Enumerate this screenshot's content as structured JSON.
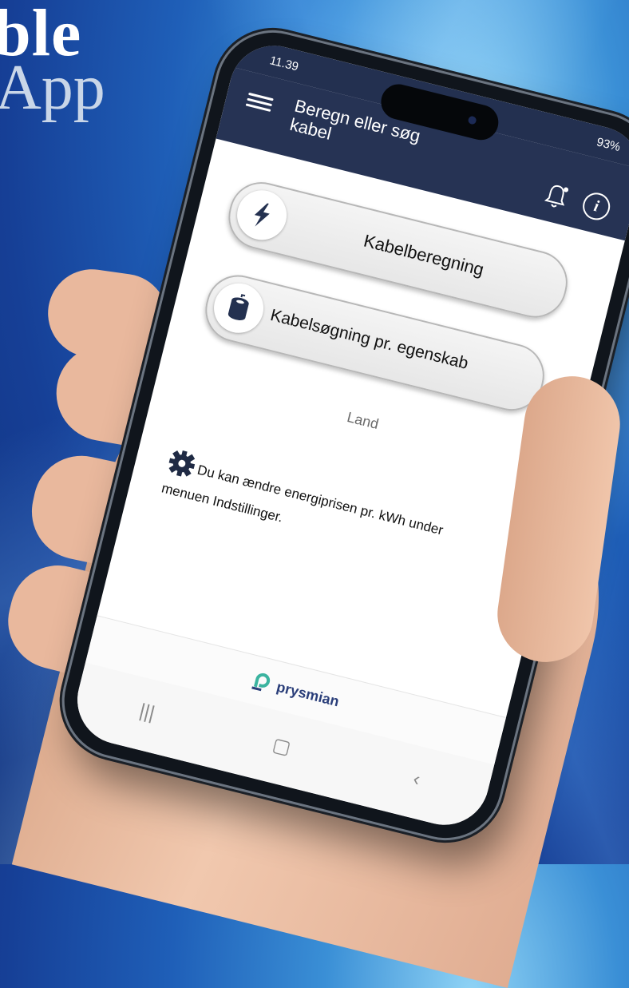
{
  "brand": {
    "top": "ble",
    "bottom": "App"
  },
  "status_bar": {
    "time": "11.39",
    "battery": "93%"
  },
  "app_bar": {
    "menu_icon": "hamburger-menu-icon",
    "title": "Beregn eller søg kabel",
    "notification_icon": "bell-icon",
    "info_icon": "info-icon",
    "info_glyph": "i"
  },
  "main": {
    "buttons": [
      {
        "label": "Kabelberegning",
        "icon": "lightning-bolt-icon"
      },
      {
        "label": "Kabelsøgning pr. egenskab",
        "icon": "cable-reel-icon"
      }
    ],
    "country_label": "Land",
    "tip": {
      "icon": "gear-icon",
      "text": "Du kan ændre energiprisen pr. kWh under menuen Indstillinger."
    }
  },
  "footer": {
    "logo_text": "prysmian",
    "logo_icon": "prysmian-logo-icon"
  },
  "system_nav": {
    "recent_icon": "recent-apps-icon",
    "recent_glyph": "|||",
    "home_icon": "home-icon",
    "home_glyph": "▢",
    "back_icon": "back-icon",
    "back_glyph": "‹"
  },
  "colors": {
    "app_bar": "#263354",
    "screen": "#ffffff",
    "background": "#1f5fb8"
  }
}
